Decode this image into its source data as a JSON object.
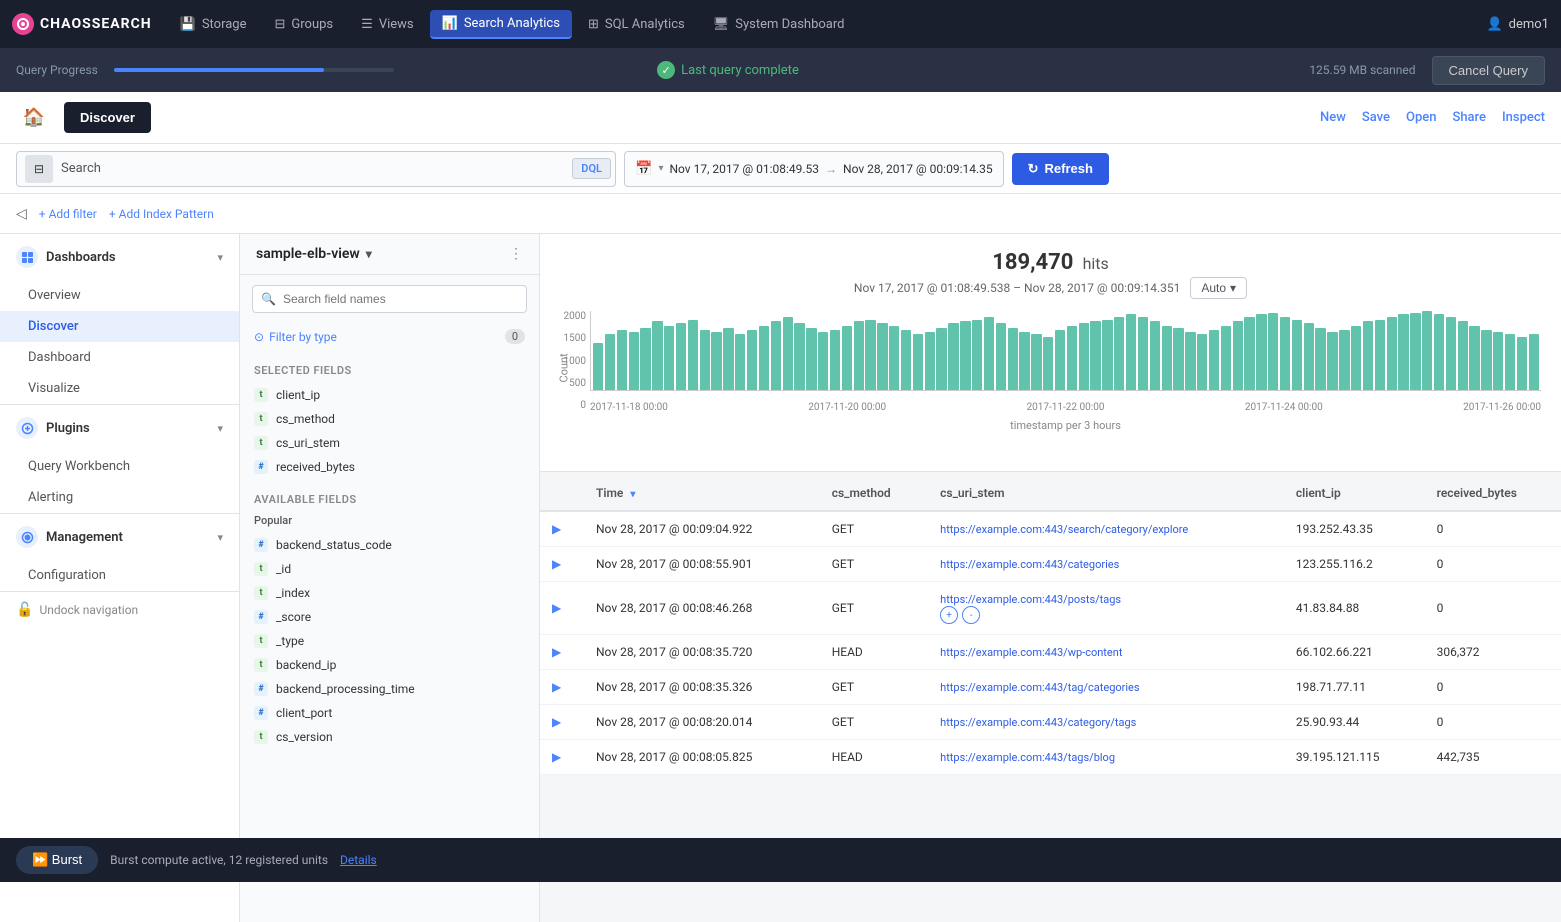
{
  "app": {
    "logo_text": "CHAOSSEARCH",
    "logo_initials": "CS"
  },
  "nav": {
    "items": [
      {
        "label": "Storage",
        "icon": "💾",
        "active": false
      },
      {
        "label": "Groups",
        "icon": "◧",
        "active": false
      },
      {
        "label": "Views",
        "icon": "☰",
        "active": false
      },
      {
        "label": "Search Analytics",
        "icon": "📊",
        "active": true
      },
      {
        "label": "SQL Analytics",
        "icon": "⊞",
        "active": false
      },
      {
        "label": "System Dashboard",
        "icon": "🖥",
        "active": false
      }
    ],
    "user": "demo1"
  },
  "query_bar": {
    "label": "Query Progress",
    "status": "Last query complete",
    "scanned": "125.59 MB scanned",
    "cancel": "Cancel Query"
  },
  "toolbar": {
    "discover": "Discover",
    "new": "New",
    "save": "Save",
    "open": "Open",
    "share": "Share",
    "inspect": "Inspect"
  },
  "search_bar": {
    "placeholder": "Search",
    "dql_label": "DQL",
    "date_start": "Nov 17, 2017 @ 01:08:49.53",
    "date_end": "Nov 28, 2017 @ 00:09:14.35",
    "refresh": "Refresh"
  },
  "filter_bar": {
    "add_filter": "+ Add filter",
    "add_index": "+ Add Index Pattern"
  },
  "sidebar": {
    "dashboards_label": "Dashboards",
    "overview": "Overview",
    "discover": "Discover",
    "dashboard": "Dashboard",
    "visualize": "Visualize",
    "plugins_label": "Plugins",
    "query_workbench": "Query Workbench",
    "alerting": "Alerting",
    "management_label": "Management",
    "configuration": "Configuration",
    "undock": "Undock navigation"
  },
  "index_panel": {
    "title": "sample-elb-view",
    "search_placeholder": "Search field names",
    "filter_type": "Filter by type",
    "filter_count": "0",
    "selected_fields_label": "Selected fields",
    "selected_fields": [
      {
        "type": "t",
        "name": "client_ip"
      },
      {
        "type": "t",
        "name": "cs_method"
      },
      {
        "type": "t",
        "name": "cs_uri_stem"
      },
      {
        "type": "#",
        "name": "received_bytes"
      }
    ],
    "available_fields_label": "Available fields",
    "popular_label": "Popular",
    "available_fields": [
      {
        "type": "#",
        "name": "backend_status_code"
      },
      {
        "type": "t",
        "name": "_id"
      },
      {
        "type": "t",
        "name": "_index"
      },
      {
        "type": "#",
        "name": "_score"
      },
      {
        "type": "t",
        "name": "_type"
      },
      {
        "type": "t",
        "name": "backend_ip"
      },
      {
        "type": "#",
        "name": "backend_processing_time"
      },
      {
        "type": "#",
        "name": "client_port"
      },
      {
        "type": "t",
        "name": "cs_version"
      }
    ]
  },
  "histogram": {
    "hits": "189,470",
    "hits_label": "hits",
    "date_range": "Nov 17, 2017 @ 01:08:49.538 – Nov 28, 2017 @ 00:09:14.351",
    "auto_label": "Auto",
    "y_labels": [
      "2000",
      "1500",
      "1000",
      "500",
      "0"
    ],
    "x_labels": [
      "2017-11-18 00:00",
      "2017-11-20 00:00",
      "2017-11-22 00:00",
      "2017-11-24 00:00",
      "2017-11-26 00:00"
    ],
    "timestamp_label": "timestamp per 3 hours",
    "y_axis_label": "Count",
    "bars": [
      55,
      65,
      70,
      68,
      72,
      80,
      75,
      78,
      82,
      70,
      68,
      72,
      65,
      70,
      75,
      80,
      85,
      78,
      72,
      68,
      70,
      75,
      80,
      82,
      78,
      75,
      70,
      65,
      68,
      72,
      78,
      80,
      82,
      85,
      78,
      72,
      68,
      65,
      62,
      70,
      75,
      78,
      80,
      82,
      85,
      88,
      85,
      80,
      75,
      72,
      68,
      65,
      70,
      75,
      80,
      85,
      88,
      90,
      85,
      82,
      78,
      72,
      68,
      70,
      75,
      80,
      82,
      85,
      88,
      90,
      92,
      88,
      85,
      80,
      75,
      70,
      68,
      65,
      62,
      65
    ]
  },
  "table": {
    "columns": [
      "Time",
      "cs_method",
      "cs_uri_stem",
      "client_ip",
      "received_bytes"
    ],
    "rows": [
      {
        "time": "Nov 28, 2017 @ 00:09:04.922",
        "method": "GET",
        "uri": "https://example.com:443/search/category/explore",
        "ip": "193.252.43.35",
        "bytes": "0"
      },
      {
        "time": "Nov 28, 2017 @ 00:08:55.901",
        "method": "GET",
        "uri": "https://example.com:443/categories",
        "ip": "123.255.116.2",
        "bytes": "0"
      },
      {
        "time": "Nov 28, 2017 @ 00:08:46.268",
        "method": "GET",
        "uri": "https://example.com:443/posts/tags",
        "ip": "41.83.84.88",
        "bytes": "0"
      },
      {
        "time": "Nov 28, 2017 @ 00:08:35.720",
        "method": "HEAD",
        "uri": "https://example.com:443/wp-content",
        "ip": "66.102.66.221",
        "bytes": "306,372"
      },
      {
        "time": "Nov 28, 2017 @ 00:08:35.326",
        "method": "GET",
        "uri": "https://example.com:443/tag/categories",
        "ip": "198.71.77.11",
        "bytes": "0"
      },
      {
        "time": "Nov 28, 2017 @ 00:08:20.014",
        "method": "GET",
        "uri": "https://example.com:443/category/tags",
        "ip": "25.90.93.44",
        "bytes": "0"
      },
      {
        "time": "Nov 28, 2017 @ 00:08:05.825",
        "method": "HEAD",
        "uri": "https://example.com:443/tags/blog",
        "ip": "39.195.121.115",
        "bytes": "442,735"
      }
    ]
  },
  "burst_bar": {
    "button": "⏩ Burst",
    "label": "Burst compute active, 12 registered units",
    "details": "Details"
  }
}
